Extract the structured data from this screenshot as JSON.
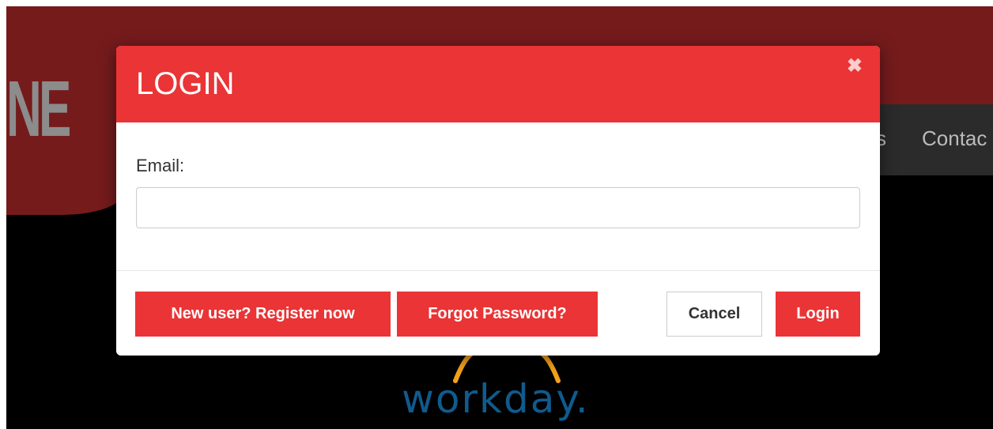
{
  "background": {
    "logo_fragment": "NE",
    "nav_item_partial": "s",
    "nav_item_contact": "Contac",
    "partner_logo_text": "workday."
  },
  "modal": {
    "title": "LOGIN",
    "close_glyph": "✖",
    "email_label": "Email:",
    "email_value": "",
    "email_placeholder": "",
    "buttons": {
      "register": "New user? Register now",
      "forgot": "Forgot Password?",
      "cancel": "Cancel",
      "login": "Login"
    }
  },
  "colors": {
    "accent_red": "#ea3435",
    "header_dark_red": "#751b1c",
    "workday_blue": "#0f5b8e",
    "workday_arc_orange": "#f4a21d"
  }
}
